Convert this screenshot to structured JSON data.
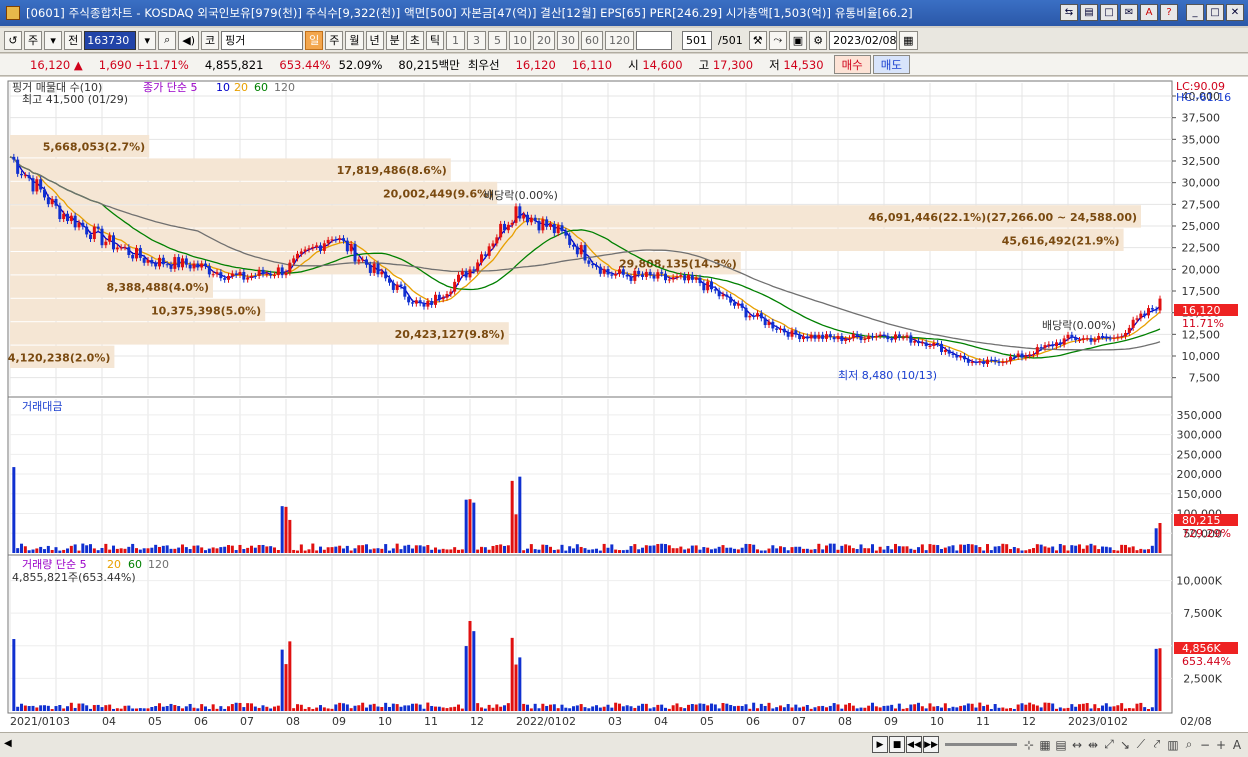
{
  "window": {
    "title": "[0601] 주식종합차트 - KOSDAQ 외국인보유[979(천)] 주식수[9,322(천)] 액면[500] 자본금[47(억)] 결산[12월] EPS[65] PER[246.29] 시가총액[1,503(억)] 유통비율[66.2]",
    "buttons": [
      "link-icon",
      "chart-icon",
      "window-icon",
      "message-icon",
      "a-icon",
      "help-icon",
      "minimize-icon",
      "maximize-icon",
      "close-icon"
    ]
  },
  "toolbar": {
    "mode": "주",
    "jeon": "전",
    "code": "163730",
    "market": "코",
    "name": "핑거",
    "periods": [
      "일",
      "주",
      "월",
      "년",
      "분",
      "초",
      "틱"
    ],
    "selected_period": "일",
    "minutes": [
      "1",
      "3",
      "5",
      "10",
      "20",
      "30",
      "60",
      "120"
    ],
    "count": "501",
    "count_total": "/501",
    "date": "2023/02/08"
  },
  "quote": {
    "price": "16,120",
    "arrow": "▲",
    "change": "1,690",
    "change_pct": "+11.71%",
    "volume": "4,855,821",
    "volume_pct": "653.44%",
    "ratio": "52.09%",
    "amount": "80,215백만",
    "best_label": "최우선",
    "best_sell": "16,120",
    "best_buy": "16,110",
    "open_label": "시",
    "open": "14,600",
    "high_label": "고",
    "high": "17,300",
    "low_label": "저",
    "low": "14,530",
    "buy_btn": "매수",
    "sell_btn": "매도"
  },
  "price_panel": {
    "legend_name": "핑거 매물대 수(10)",
    "legend_ma": "종가 단순 5",
    "ma_periods": [
      "10",
      "20",
      "60",
      "120"
    ],
    "ma_colors": [
      "#9a00c8",
      "#0000c8",
      "#e8a000",
      "#008000",
      "#707070"
    ],
    "high_note": "최고 41,500 (01/29)",
    "low_note": "최저 8,480 (10/13)",
    "dividend1": "배당락(0.00%)",
    "dividend2": "배당락(0.00%)",
    "lc": "LC:90.09",
    "hc": "HC:-61.16",
    "last_price": "16,120",
    "last_pct": "11.71%",
    "volume_profile": [
      {
        "label": "4,120,238(2.0%)",
        "price_lo": 8500,
        "price_hi": 11200,
        "frac": 0.09
      },
      {
        "label": "20,423,127(9.8%)",
        "price_lo": 11200,
        "price_hi": 13900,
        "frac": 0.43
      },
      {
        "label": "10,375,398(5.0%)",
        "price_lo": 13900,
        "price_hi": 16600,
        "frac": 0.22
      },
      {
        "label": "8,388,488(4.0%)",
        "price_lo": 16600,
        "price_hi": 19300,
        "frac": 0.175
      },
      {
        "label": "29,808,135(14.3%)",
        "price_lo": 19300,
        "price_hi": 22000,
        "frac": 0.63
      },
      {
        "label": "45,616,492(21.9%)",
        "price_lo": 22000,
        "price_hi": 24700,
        "frac": 0.96
      },
      {
        "label": "46,091,446(22.1%)(27,266.00 ~ 24,588.00)",
        "price_lo": 24700,
        "price_hi": 27400,
        "frac": 0.975
      },
      {
        "label": "20,002,449(9.6%)",
        "price_lo": 27400,
        "price_hi": 30100,
        "frac": 0.42
      },
      {
        "label": "17,819,486(8.6%)",
        "price_lo": 30100,
        "price_hi": 32800,
        "frac": 0.38
      },
      {
        "label": "5,668,053(2.7%)",
        "price_lo": 32800,
        "price_hi": 35500,
        "frac": 0.12
      }
    ],
    "y_ticks": [
      "40,000",
      "37,500",
      "35,000",
      "32,500",
      "30,000",
      "27,500",
      "25,000",
      "22,500",
      "20,000",
      "17,500",
      "15,000",
      "12,500",
      "10,000",
      "7,500"
    ]
  },
  "amount_panel": {
    "legend": "거래대금",
    "y_ticks": [
      "350,000",
      "300,000",
      "250,000",
      "200,000",
      "150,000",
      "100,000",
      "50,000"
    ],
    "last": "80,215",
    "last_pct": "729.29%"
  },
  "volume_panel": {
    "legend": "거래량 단순 5",
    "ma_periods": [
      "20",
      "60",
      "120"
    ],
    "last_volume": "4,855,821주(653.44%)",
    "y_ticks": [
      "10,000K",
      "7,500K",
      "5,000K",
      "2,500K"
    ],
    "last": "4,856K",
    "last_pct": "653.44%"
  },
  "x_axis": [
    "2021/01",
    "03",
    "04",
    "05",
    "06",
    "07",
    "08",
    "09",
    "10",
    "11",
    "12",
    "2022/01",
    "02",
    "03",
    "04",
    "05",
    "06",
    "07",
    "08",
    "09",
    "10",
    "11",
    "12",
    "2023/01",
    "02",
    "02/08"
  ],
  "chart_data": {
    "type": "candlestick",
    "ylim": [
      7500,
      41500
    ],
    "monthly_close": [
      {
        "m": "2021/01",
        "v": 33000
      },
      {
        "m": "2021/02",
        "v": 27000
      },
      {
        "m": "2021/03",
        "v": 23500
      },
      {
        "m": "2021/04",
        "v": 21000
      },
      {
        "m": "2021/05",
        "v": 20500
      },
      {
        "m": "2021/06",
        "v": 19000
      },
      {
        "m": "2021/07",
        "v": 20000
      },
      {
        "m": "2021/08",
        "v": 24000
      },
      {
        "m": "2021/09",
        "v": 19500
      },
      {
        "m": "2021/10",
        "v": 15500
      },
      {
        "m": "2021/11",
        "v": 20000
      },
      {
        "m": "2021/12",
        "v": 27000
      },
      {
        "m": "2022/01",
        "v": 24000
      },
      {
        "m": "2022/02",
        "v": 19500
      },
      {
        "m": "2022/03",
        "v": 19000
      },
      {
        "m": "2022/04",
        "v": 18500
      },
      {
        "m": "2022/05",
        "v": 15000
      },
      {
        "m": "2022/06",
        "v": 12500
      },
      {
        "m": "2022/07",
        "v": 12000
      },
      {
        "m": "2022/08",
        "v": 12500
      },
      {
        "m": "2022/09",
        "v": 11500
      },
      {
        "m": "2022/10",
        "v": 9000
      },
      {
        "m": "2022/11",
        "v": 10000
      },
      {
        "m": "2022/12",
        "v": 12000
      },
      {
        "m": "2023/01",
        "v": 12000
      },
      {
        "m": "2023/02",
        "v": 16120
      }
    ],
    "amount_spikes": [
      {
        "m": "2021/01",
        "v": 350000
      },
      {
        "m": "2021/07",
        "v": 120000
      },
      {
        "m": "2021/11",
        "v": 170000
      },
      {
        "m": "2021/12",
        "v": 195000
      },
      {
        "m": "2023/02",
        "v": 80215
      }
    ],
    "volume_spikes": [
      {
        "m": "2021/01",
        "v": 10500
      },
      {
        "m": "2021/07",
        "v": 5800
      },
      {
        "m": "2021/11",
        "v": 7500
      },
      {
        "m": "2021/12",
        "v": 6500
      },
      {
        "m": "2023/02",
        "v": 4856
      }
    ]
  }
}
